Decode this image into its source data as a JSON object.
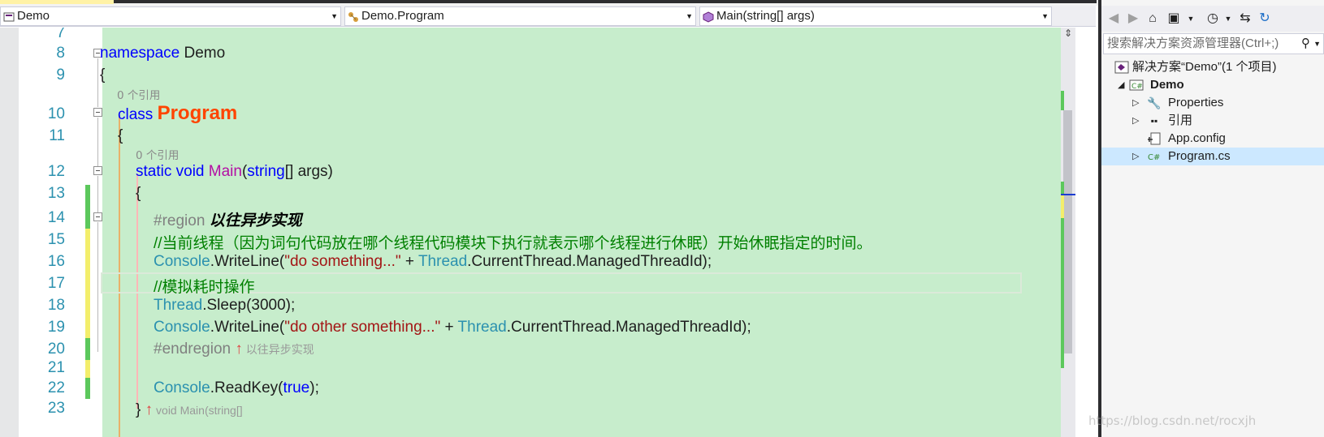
{
  "nav": {
    "project": "Demo",
    "class": "Demo.Program",
    "member": "Main(string[] args)"
  },
  "editor": {
    "lines": [
      {
        "n": "7"
      },
      {
        "n": "8"
      },
      {
        "n": "9"
      },
      {
        "n": "10"
      },
      {
        "n": "11"
      },
      {
        "n": "12"
      },
      {
        "n": "13"
      },
      {
        "n": "14"
      },
      {
        "n": "15"
      },
      {
        "n": "16"
      },
      {
        "n": "17"
      },
      {
        "n": "18"
      },
      {
        "n": "19"
      },
      {
        "n": "20"
      },
      {
        "n": "21"
      },
      {
        "n": "22"
      },
      {
        "n": "23"
      }
    ],
    "code": {
      "l8_kw": "namespace",
      "l8_name": " Demo",
      "l9": "{",
      "lens1": "0 个引用",
      "l10_kw": "class ",
      "l10_name": "Program",
      "l11": "{",
      "lens2": "0 个引用",
      "l12_kw1": "static ",
      "l12_kw2": "void ",
      "l12_name": "Main",
      "l12_p1": "(",
      "l12_kw3": "string",
      "l12_p2": "[] args)",
      "l13": "{",
      "l14_pre": "#region ",
      "l14_name": "以往异步实现",
      "l15": "//当前线程（因为词句代码放在哪个线程代码模块下执行就表示哪个线程进行休眠）开始休眠指定的时间。",
      "l16_t1": "Console",
      "l16_a": ".WriteLine(",
      "l16_s": "\"do something...\"",
      "l16_b": " + ",
      "l16_t2": "Thread",
      "l16_c": ".CurrentThread.ManagedThreadId);",
      "l17": "//模拟耗时操作",
      "l18_t": "Thread",
      "l18_a": ".Sleep(3000);",
      "l19_t1": "Console",
      "l19_a": ".WriteLine(",
      "l19_s": "\"do other something...\"",
      "l19_b": " + ",
      "l19_t2": "Thread",
      "l19_c": ".CurrentThread.ManagedThreadId);",
      "l20_pre": "#endregion",
      "l20_arrow": " ↑",
      "l20_hint": " 以往异步实现",
      "l22_t": "Console",
      "l22_a": ".ReadKey(",
      "l22_kw": "true",
      "l22_b": ");",
      "l23_brace": "}",
      "l23_arrow": " ↑",
      "l23_hint": " void Main(string[]"
    }
  },
  "solution": {
    "search_placeholder": "搜索解决方案资源管理器(Ctrl+;)",
    "items": [
      {
        "label": "解决方案“Demo”(1 个项目)"
      },
      {
        "label": "Demo"
      },
      {
        "label": "Properties"
      },
      {
        "label": "引用"
      },
      {
        "label": "App.config"
      },
      {
        "label": "Program.cs"
      }
    ]
  },
  "watermark": "https://blog.csdn.net/rocxjh"
}
